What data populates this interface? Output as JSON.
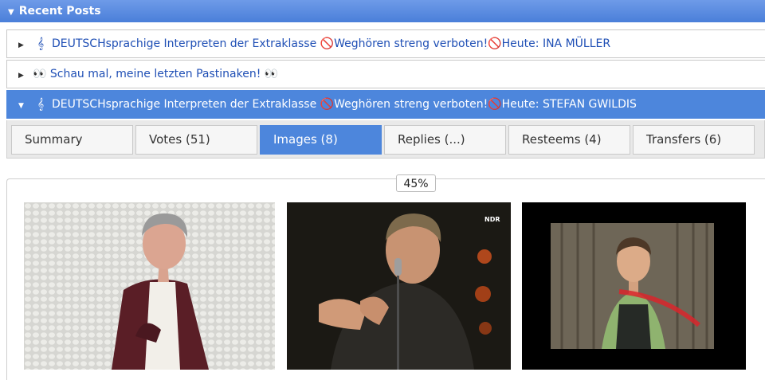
{
  "header": {
    "title": "Recent Posts"
  },
  "posts": [
    {
      "prefix": "DEUTSCHsprachige Interpreten der Extraklasse ",
      "middle": "Weghören streng verboten!",
      "suffix": "Heute: INA MÜLLER"
    },
    {
      "text": "Schau mal, meine letzten Pastinaken!"
    },
    {
      "prefix": "DEUTSCHsprachige Interpreten der Extraklasse ",
      "middle": "Weghören streng verboten!",
      "suffix": "Heute: STEFAN GWILDIS"
    }
  ],
  "tabs": [
    "Summary",
    "Votes (51)",
    "Images (8)",
    "Replies (...)",
    "Resteems (4)",
    "Transfers (6)"
  ],
  "progress": {
    "label": "45%",
    "value": 45
  },
  "images": [
    {
      "name": "man-in-jacket-photo"
    },
    {
      "name": "singer-on-stage-photo",
      "watermark": "NDR"
    },
    {
      "name": "boy-on-stage-photo"
    }
  ],
  "colors": {
    "accent": "#4d86dc",
    "link": "#1f4fb5",
    "prohibited": "#e0342b"
  }
}
